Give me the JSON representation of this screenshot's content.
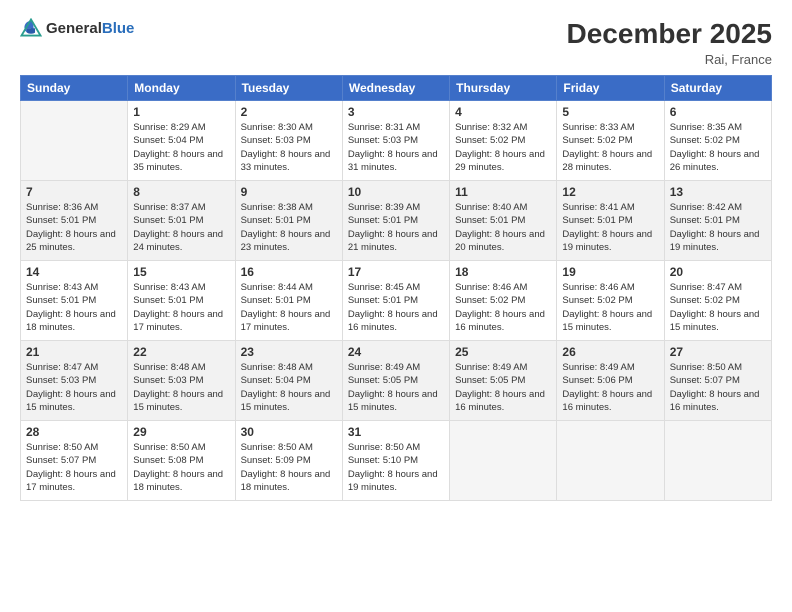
{
  "header": {
    "logo_general": "General",
    "logo_blue": "Blue",
    "title": "December 2025",
    "location": "Rai, France"
  },
  "weekdays": [
    "Sunday",
    "Monday",
    "Tuesday",
    "Wednesday",
    "Thursday",
    "Friday",
    "Saturday"
  ],
  "weeks": [
    [
      {
        "day": "",
        "sunrise": "",
        "sunset": "",
        "daylight": ""
      },
      {
        "day": "1",
        "sunrise": "Sunrise: 8:29 AM",
        "sunset": "Sunset: 5:04 PM",
        "daylight": "Daylight: 8 hours and 35 minutes."
      },
      {
        "day": "2",
        "sunrise": "Sunrise: 8:30 AM",
        "sunset": "Sunset: 5:03 PM",
        "daylight": "Daylight: 8 hours and 33 minutes."
      },
      {
        "day": "3",
        "sunrise": "Sunrise: 8:31 AM",
        "sunset": "Sunset: 5:03 PM",
        "daylight": "Daylight: 8 hours and 31 minutes."
      },
      {
        "day": "4",
        "sunrise": "Sunrise: 8:32 AM",
        "sunset": "Sunset: 5:02 PM",
        "daylight": "Daylight: 8 hours and 29 minutes."
      },
      {
        "day": "5",
        "sunrise": "Sunrise: 8:33 AM",
        "sunset": "Sunset: 5:02 PM",
        "daylight": "Daylight: 8 hours and 28 minutes."
      },
      {
        "day": "6",
        "sunrise": "Sunrise: 8:35 AM",
        "sunset": "Sunset: 5:02 PM",
        "daylight": "Daylight: 8 hours and 26 minutes."
      }
    ],
    [
      {
        "day": "7",
        "sunrise": "Sunrise: 8:36 AM",
        "sunset": "Sunset: 5:01 PM",
        "daylight": "Daylight: 8 hours and 25 minutes."
      },
      {
        "day": "8",
        "sunrise": "Sunrise: 8:37 AM",
        "sunset": "Sunset: 5:01 PM",
        "daylight": "Daylight: 8 hours and 24 minutes."
      },
      {
        "day": "9",
        "sunrise": "Sunrise: 8:38 AM",
        "sunset": "Sunset: 5:01 PM",
        "daylight": "Daylight: 8 hours and 23 minutes."
      },
      {
        "day": "10",
        "sunrise": "Sunrise: 8:39 AM",
        "sunset": "Sunset: 5:01 PM",
        "daylight": "Daylight: 8 hours and 21 minutes."
      },
      {
        "day": "11",
        "sunrise": "Sunrise: 8:40 AM",
        "sunset": "Sunset: 5:01 PM",
        "daylight": "Daylight: 8 hours and 20 minutes."
      },
      {
        "day": "12",
        "sunrise": "Sunrise: 8:41 AM",
        "sunset": "Sunset: 5:01 PM",
        "daylight": "Daylight: 8 hours and 19 minutes."
      },
      {
        "day": "13",
        "sunrise": "Sunrise: 8:42 AM",
        "sunset": "Sunset: 5:01 PM",
        "daylight": "Daylight: 8 hours and 19 minutes."
      }
    ],
    [
      {
        "day": "14",
        "sunrise": "Sunrise: 8:43 AM",
        "sunset": "Sunset: 5:01 PM",
        "daylight": "Daylight: 8 hours and 18 minutes."
      },
      {
        "day": "15",
        "sunrise": "Sunrise: 8:43 AM",
        "sunset": "Sunset: 5:01 PM",
        "daylight": "Daylight: 8 hours and 17 minutes."
      },
      {
        "day": "16",
        "sunrise": "Sunrise: 8:44 AM",
        "sunset": "Sunset: 5:01 PM",
        "daylight": "Daylight: 8 hours and 17 minutes."
      },
      {
        "day": "17",
        "sunrise": "Sunrise: 8:45 AM",
        "sunset": "Sunset: 5:01 PM",
        "daylight": "Daylight: 8 hours and 16 minutes."
      },
      {
        "day": "18",
        "sunrise": "Sunrise: 8:46 AM",
        "sunset": "Sunset: 5:02 PM",
        "daylight": "Daylight: 8 hours and 16 minutes."
      },
      {
        "day": "19",
        "sunrise": "Sunrise: 8:46 AM",
        "sunset": "Sunset: 5:02 PM",
        "daylight": "Daylight: 8 hours and 15 minutes."
      },
      {
        "day": "20",
        "sunrise": "Sunrise: 8:47 AM",
        "sunset": "Sunset: 5:02 PM",
        "daylight": "Daylight: 8 hours and 15 minutes."
      }
    ],
    [
      {
        "day": "21",
        "sunrise": "Sunrise: 8:47 AM",
        "sunset": "Sunset: 5:03 PM",
        "daylight": "Daylight: 8 hours and 15 minutes."
      },
      {
        "day": "22",
        "sunrise": "Sunrise: 8:48 AM",
        "sunset": "Sunset: 5:03 PM",
        "daylight": "Daylight: 8 hours and 15 minutes."
      },
      {
        "day": "23",
        "sunrise": "Sunrise: 8:48 AM",
        "sunset": "Sunset: 5:04 PM",
        "daylight": "Daylight: 8 hours and 15 minutes."
      },
      {
        "day": "24",
        "sunrise": "Sunrise: 8:49 AM",
        "sunset": "Sunset: 5:05 PM",
        "daylight": "Daylight: 8 hours and 15 minutes."
      },
      {
        "day": "25",
        "sunrise": "Sunrise: 8:49 AM",
        "sunset": "Sunset: 5:05 PM",
        "daylight": "Daylight: 8 hours and 16 minutes."
      },
      {
        "day": "26",
        "sunrise": "Sunrise: 8:49 AM",
        "sunset": "Sunset: 5:06 PM",
        "daylight": "Daylight: 8 hours and 16 minutes."
      },
      {
        "day": "27",
        "sunrise": "Sunrise: 8:50 AM",
        "sunset": "Sunset: 5:07 PM",
        "daylight": "Daylight: 8 hours and 16 minutes."
      }
    ],
    [
      {
        "day": "28",
        "sunrise": "Sunrise: 8:50 AM",
        "sunset": "Sunset: 5:07 PM",
        "daylight": "Daylight: 8 hours and 17 minutes."
      },
      {
        "day": "29",
        "sunrise": "Sunrise: 8:50 AM",
        "sunset": "Sunset: 5:08 PM",
        "daylight": "Daylight: 8 hours and 18 minutes."
      },
      {
        "day": "30",
        "sunrise": "Sunrise: 8:50 AM",
        "sunset": "Sunset: 5:09 PM",
        "daylight": "Daylight: 8 hours and 18 minutes."
      },
      {
        "day": "31",
        "sunrise": "Sunrise: 8:50 AM",
        "sunset": "Sunset: 5:10 PM",
        "daylight": "Daylight: 8 hours and 19 minutes."
      },
      {
        "day": "",
        "sunrise": "",
        "sunset": "",
        "daylight": ""
      },
      {
        "day": "",
        "sunrise": "",
        "sunset": "",
        "daylight": ""
      },
      {
        "day": "",
        "sunrise": "",
        "sunset": "",
        "daylight": ""
      }
    ]
  ]
}
